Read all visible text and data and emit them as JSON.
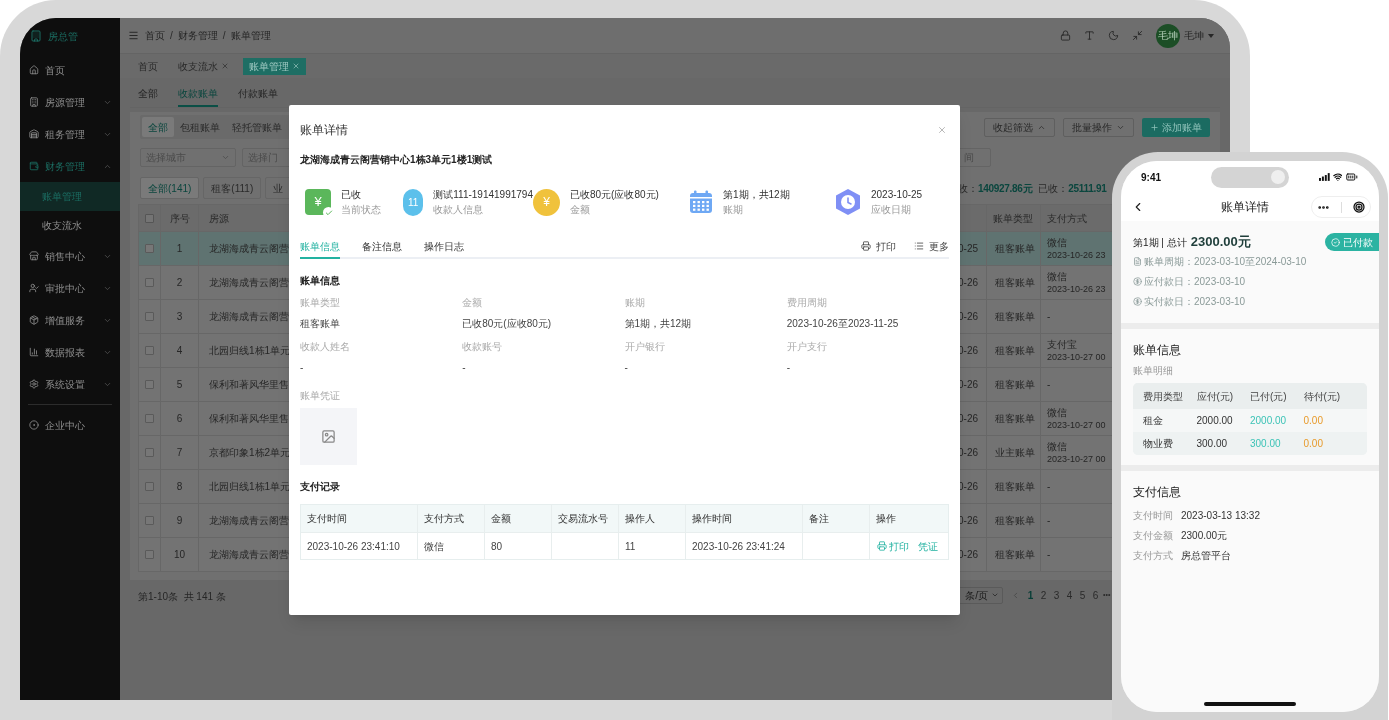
{
  "sidebar": {
    "logo": "房总管",
    "items": [
      {
        "kind": "link",
        "label": "首页"
      },
      {
        "kind": "group",
        "label": "房源管理",
        "expanded": false
      },
      {
        "kind": "group",
        "label": "租务管理",
        "expanded": false
      },
      {
        "kind": "group",
        "label": "财务管理",
        "expanded": true,
        "children": [
          {
            "label": "账单管理",
            "selected": true
          },
          {
            "label": "收支流水",
            "selected": false
          }
        ]
      },
      {
        "kind": "group",
        "label": "销售中心",
        "expanded": false
      },
      {
        "kind": "group",
        "label": "审批中心",
        "expanded": false
      },
      {
        "kind": "group",
        "label": "增值服务",
        "expanded": false
      },
      {
        "kind": "group",
        "label": "数据报表",
        "expanded": false
      },
      {
        "kind": "group",
        "label": "系统设置",
        "expanded": false
      },
      {
        "kind": "footer",
        "label": "企业中心"
      }
    ]
  },
  "topbar": {
    "breadcrumb": [
      "首页",
      "财务管理",
      "账单管理"
    ],
    "separator": "/",
    "avatar_text": "毛坤",
    "user_name": "毛坤"
  },
  "page_tabs": [
    {
      "label": "首页",
      "closable": false,
      "selected": false
    },
    {
      "label": "收支流水",
      "closable": true,
      "selected": false
    },
    {
      "label": "账单管理",
      "closable": true,
      "selected": true
    }
  ],
  "bill_tabs": [
    {
      "label": "全部",
      "selected": false
    },
    {
      "label": "收款账单",
      "selected": true
    },
    {
      "label": "付款账单",
      "selected": false
    }
  ],
  "type_tabs": [
    {
      "label": "全部",
      "selected": true
    },
    {
      "label": "包租账单",
      "selected": false
    },
    {
      "label": "轻托管账单",
      "selected": false
    }
  ],
  "toolbar_buttons": [
    {
      "kind": "outline",
      "label": "收起筛选",
      "expanded": true
    },
    {
      "kind": "outline",
      "label": "批量操作",
      "expanded": false
    },
    {
      "kind": "primary",
      "label": "添加账单"
    }
  ],
  "filters": [
    {
      "placeholder": "选择城市",
      "dropdown": true
    },
    {
      "placeholder": "选择门"
    }
  ],
  "date_filter": {
    "placeholder": "间"
  },
  "count_buttons": [
    {
      "label": "全部(141)",
      "selected": true
    },
    {
      "label": "租客(111)",
      "selected": false
    },
    {
      "label": "业",
      "selected": false
    }
  ],
  "summary": [
    {
      "label": "收：",
      "value": "140927.86元"
    },
    {
      "label": "已收：",
      "value": "25111.91"
    }
  ],
  "table": {
    "header_checked": false,
    "columns": {
      "seq": "序号",
      "source": "房源",
      "bill_type": "账单类型",
      "payment": "支付方式"
    },
    "rows": [
      {
        "checked": false,
        "selected": true,
        "seq": "1",
        "source": "龙湖海成青云阁营",
        "date": "0-25",
        "bill_type": "租客账单",
        "payment": [
          "微信",
          "2023-10-26 23"
        ]
      },
      {
        "checked": false,
        "selected": false,
        "seq": "2",
        "source": "龙湖海成青云阁营",
        "date": "0-26",
        "bill_type": "租客账单",
        "payment": [
          "微信",
          "2023-10-26 23"
        ]
      },
      {
        "checked": false,
        "selected": false,
        "seq": "3",
        "source": "龙湖海成青云阁营",
        "date": "0-26",
        "bill_type": "租客账单",
        "payment": [
          "-"
        ]
      },
      {
        "checked": false,
        "selected": false,
        "seq": "4",
        "source": "北园归线1栋1单元",
        "date": "0-26",
        "bill_type": "租客账单",
        "payment": [
          "支付宝",
          "2023-10-27 00"
        ]
      },
      {
        "checked": false,
        "selected": false,
        "seq": "5",
        "source": "保利和著风华里售",
        "date": "0-26",
        "bill_type": "租客账单",
        "payment": [
          "-"
        ]
      },
      {
        "checked": false,
        "selected": false,
        "seq": "6",
        "source": "保利和著风华里售",
        "date": "0-26",
        "bill_type": "租客账单",
        "payment": [
          "微信",
          "2023-10-27 00"
        ]
      },
      {
        "checked": false,
        "selected": false,
        "seq": "7",
        "source": "京都印象1栋2单元",
        "date": "0-26",
        "bill_type": "业主账单",
        "payment": [
          "微信",
          "2023-10-27 00"
        ]
      },
      {
        "checked": false,
        "selected": false,
        "seq": "8",
        "source": "北园归线1栋1单元",
        "date": "0-26",
        "bill_type": "租客账单",
        "payment": [
          "-"
        ]
      },
      {
        "checked": false,
        "selected": false,
        "seq": "9",
        "source": "龙湖海成青云阁营",
        "date": "0-26",
        "bill_type": "租客账单",
        "payment": [
          "-"
        ]
      },
      {
        "checked": false,
        "selected": false,
        "seq": "10",
        "source": "龙湖海成青云阁营",
        "date": "0-26",
        "bill_type": "租客账单",
        "payment": [
          "-"
        ]
      }
    ]
  },
  "pagination": {
    "summary": "第1-10条  共 141 条",
    "page_size": "条/页",
    "pages": [
      {
        "label": "1",
        "selected": true
      },
      {
        "label": "2",
        "selected": false
      },
      {
        "label": "3",
        "selected": false
      },
      {
        "label": "4",
        "selected": false
      },
      {
        "label": "5",
        "selected": false
      },
      {
        "label": "6",
        "selected": false
      }
    ],
    "more": "•••"
  },
  "modal": {
    "title": "账单详情",
    "property": "龙湖海成青云阁营销中心1栋3单元1楼1测试",
    "stats": [
      {
        "kind": "status",
        "badge": "¥",
        "value": "已收",
        "label": "当前状态"
      },
      {
        "kind": "payee",
        "badge": "11",
        "value": "测试111-19141991794",
        "label": "收款人信息"
      },
      {
        "kind": "amount",
        "badge": "¥",
        "value": "已收80元(应收80元)",
        "label": "金额"
      },
      {
        "kind": "period",
        "value": "第1期，共12期",
        "label": "账期"
      },
      {
        "kind": "date",
        "value": "2023-10-25",
        "label": "应收日期"
      }
    ],
    "tabs": [
      {
        "label": "账单信息",
        "selected": true
      },
      {
        "label": "备注信息",
        "selected": false
      },
      {
        "label": "操作日志",
        "selected": false
      }
    ],
    "actions": [
      {
        "kind": "print",
        "label": "打印"
      },
      {
        "kind": "more",
        "label": "更多"
      }
    ],
    "info_title": "账单信息",
    "fields": [
      {
        "label": "账单类型",
        "value": "租客账单"
      },
      {
        "label": "金额",
        "value": "已收80元(应收80元)"
      },
      {
        "label": "账期",
        "value": "第1期，共12期"
      },
      {
        "label": "费用周期",
        "value": "2023-10-26至2023-11-25"
      },
      {
        "label": "收款人姓名",
        "value": "-"
      },
      {
        "label": "收款账号",
        "value": "-"
      },
      {
        "label": "开户银行",
        "value": "-"
      },
      {
        "label": "开户支行",
        "value": "-"
      }
    ],
    "voucher_label": "账单凭证",
    "payments": {
      "title": "支付记录",
      "columns": [
        "支付时间",
        "支付方式",
        "金额",
        "交易流水号",
        "操作人",
        "操作时间",
        "备注",
        "操作"
      ],
      "rows": [
        {
          "cells": [
            "2023-10-26 23:41:10",
            "微信",
            "80",
            null,
            "11",
            "2023-10-26 23:41:24",
            null
          ],
          "actions": [
            {
              "kind": "print",
              "label": "打印"
            },
            {
              "kind": "voucher",
              "label": "凭证"
            }
          ]
        }
      ]
    }
  },
  "phone": {
    "time": "9:41",
    "title": "账单详情",
    "period": "第1期 | 总计",
    "total": "2300.00元",
    "badge": "已付款",
    "dates": [
      {
        "label": "账单周期：",
        "value": "2023-03-10至2024-03-10"
      },
      {
        "label": "应付款日：",
        "value": "2023-03-10"
      },
      {
        "label": "实付款日：",
        "value": "2023-03-10"
      }
    ],
    "bill_section": "账单信息",
    "detail_label": "账单明细",
    "fee_table": {
      "columns": [
        "费用类型",
        "应付(元)",
        "已付(元)",
        "待付(元)"
      ],
      "rows": [
        [
          "租金",
          "2000.00",
          "2000.00",
          "0.00"
        ],
        [
          "物业费",
          "300.00",
          "300.00",
          "0.00"
        ]
      ]
    },
    "pay_section": "支付信息",
    "pay_rows": [
      {
        "label": "支付时间",
        "value": "2023-03-13 13:32"
      },
      {
        "label": "支付金额",
        "value": "2300.00元"
      },
      {
        "label": "支付方式",
        "value": "房总管平台"
      }
    ]
  }
}
